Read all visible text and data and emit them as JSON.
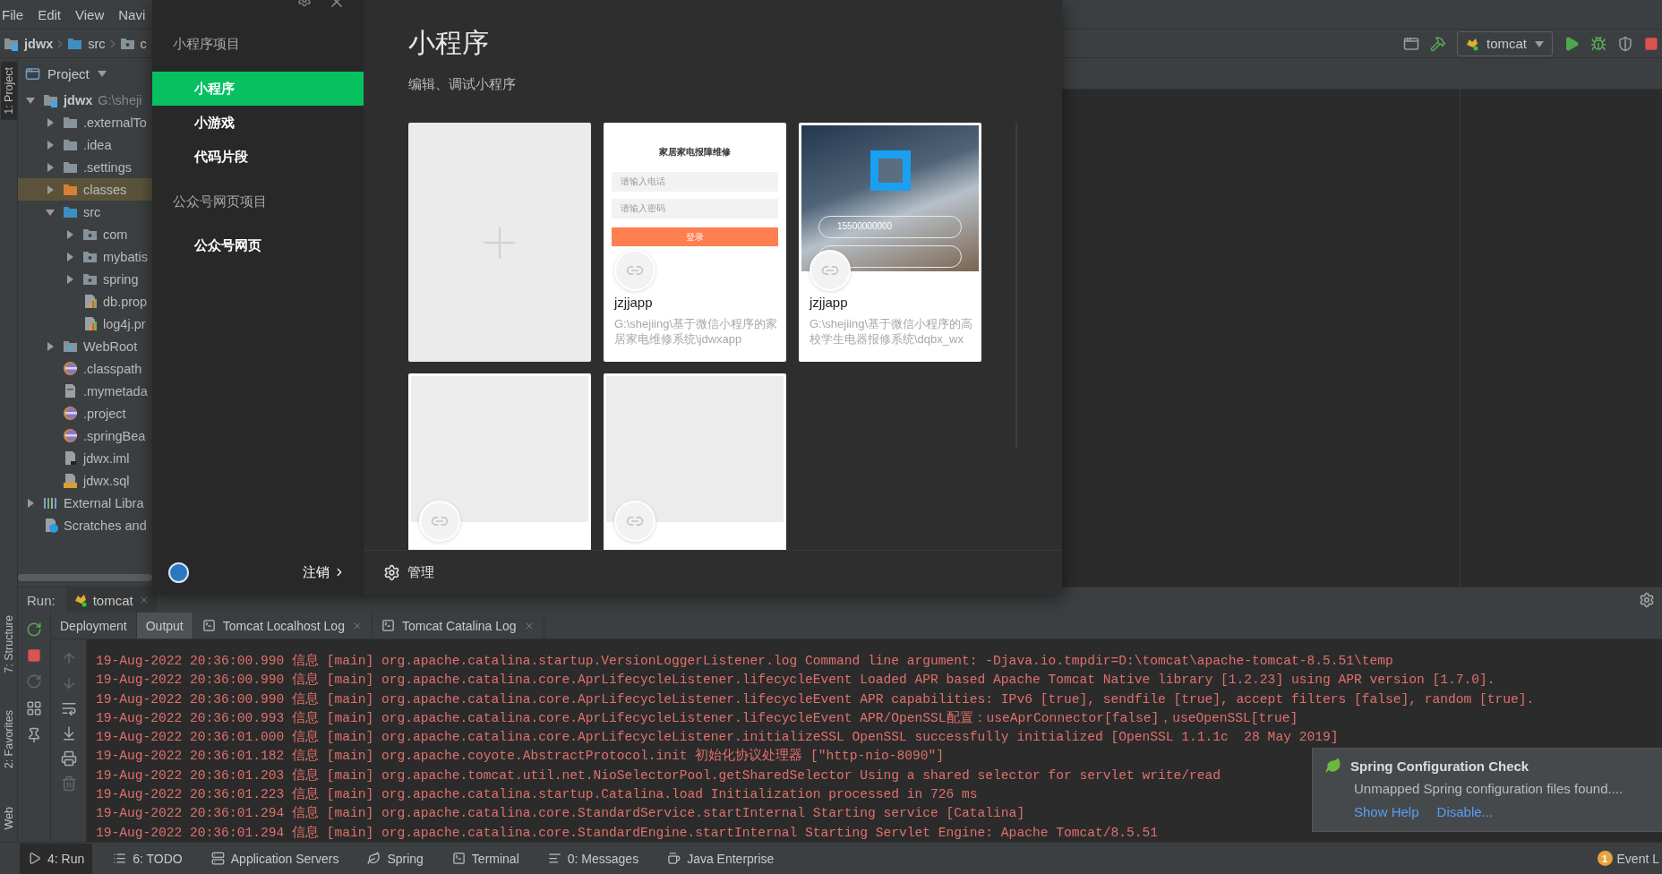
{
  "menu": [
    "File",
    "Edit",
    "View",
    "Navi"
  ],
  "breadcrumb": [
    {
      "label": "jdwx",
      "kind": "module"
    },
    {
      "label": "src",
      "kind": "source"
    },
    {
      "label": "c",
      "kind": "package"
    }
  ],
  "toolbar": {
    "run_config": "tomcat"
  },
  "side_stripe": {
    "top": [
      {
        "label": "1: Project",
        "selected": true
      }
    ],
    "bottom": [
      {
        "label": "7: Structure",
        "selected": false
      },
      {
        "label": "2: Favorites",
        "selected": false
      },
      {
        "label": "Web",
        "selected": false
      }
    ]
  },
  "project_panel": {
    "title": "Project",
    "tree": [
      {
        "name": "jdwx",
        "path": "G:\\sheji",
        "kind": "module",
        "expanded": true,
        "selected": false,
        "children": [
          {
            "name": ".externalTo",
            "kind": "folder",
            "expanded": false,
            "selected": false
          },
          {
            "name": ".idea",
            "kind": "folder",
            "expanded": false,
            "selected": false
          },
          {
            "name": ".settings",
            "kind": "folder",
            "expanded": false,
            "selected": false
          },
          {
            "name": "classes",
            "kind": "excluded",
            "expanded": false,
            "selected": true
          },
          {
            "name": "src",
            "kind": "source",
            "expanded": true,
            "selected": false,
            "children": [
              {
                "name": "com",
                "kind": "package",
                "expanded": false,
                "selected": false
              },
              {
                "name": "mybatis",
                "kind": "package",
                "expanded": false,
                "selected": false
              },
              {
                "name": "spring",
                "kind": "package",
                "expanded": false,
                "selected": false
              },
              {
                "name": "db.prop",
                "kind": "properties",
                "selected": false
              },
              {
                "name": "log4j.pr",
                "kind": "properties",
                "selected": false
              }
            ]
          },
          {
            "name": "WebRoot",
            "kind": "web",
            "expanded": false,
            "selected": false
          },
          {
            "name": ".classpath",
            "kind": "eclipse",
            "selected": false
          },
          {
            "name": ".mymetada",
            "kind": "file",
            "selected": false
          },
          {
            "name": ".project",
            "kind": "eclipse",
            "selected": false
          },
          {
            "name": ".springBea",
            "kind": "eclipse",
            "selected": false
          },
          {
            "name": "jdwx.iml",
            "kind": "iml",
            "selected": false
          },
          {
            "name": "jdwx.sql",
            "kind": "sql",
            "selected": false
          }
        ]
      },
      {
        "name": "External Libra",
        "kind": "library",
        "expanded": false,
        "selected": false
      },
      {
        "name": "Scratches and",
        "kind": "scratch",
        "selected": false
      }
    ]
  },
  "dialog": {
    "sidebar": {
      "sections": [
        {
          "title": "小程序项目",
          "items": [
            {
              "label": "小程序",
              "selected": true
            },
            {
              "label": "小游戏",
              "selected": false
            },
            {
              "label": "代码片段",
              "selected": false
            }
          ]
        },
        {
          "title": "公众号网页项目",
          "items": [
            {
              "label": "公众号网页",
              "selected": false
            }
          ]
        }
      ],
      "logout": "注销"
    },
    "main": {
      "title": "小程序",
      "subtitle": "编辑、调试小程序",
      "projects": [
        {
          "kind": "new"
        },
        {
          "kind": "project",
          "name": "jzjjapp",
          "path": "G:\\shejiing\\基于微信小程序的家居家电维修系统\\jdwxapp",
          "preview": {
            "kind": "form",
            "title": "家居家电报障维修",
            "fields": [
              "请输入电话",
              "请输入密码"
            ],
            "button": "登录"
          }
        },
        {
          "kind": "project",
          "name": "jzjjapp",
          "path": "G:\\shejiing\\基于微信小程序的高校学生电器报修系统\\dqbx_wx",
          "preview": {
            "kind": "photo",
            "field": "15500000000"
          }
        },
        {
          "kind": "project",
          "preview": {
            "kind": "blank"
          }
        },
        {
          "kind": "project",
          "preview": {
            "kind": "blank"
          }
        }
      ],
      "manage": "管理"
    }
  },
  "run_panel": {
    "label": "Run:",
    "session": "tomcat",
    "tabs": [
      {
        "label": "Deployment",
        "kind": "plain",
        "selected": false
      },
      {
        "label": "Output",
        "kind": "plain",
        "selected": true
      },
      {
        "label": "Tomcat Localhost Log",
        "kind": "log",
        "selected": false
      },
      {
        "label": "Tomcat Catalina Log",
        "kind": "log",
        "selected": false
      }
    ],
    "lines": [
      "19-Aug-2022 20:36:00.990 信息 [main] org.apache.catalina.startup.VersionLoggerListener.log Command line argument: -Djava.io.tmpdir=D:\\tomcat\\apache-tomcat-8.5.51\\temp",
      "19-Aug-2022 20:36:00.990 信息 [main] org.apache.catalina.core.AprLifecycleListener.lifecycleEvent Loaded APR based Apache Tomcat Native library [1.2.23] using APR version [1.7.0].",
      "19-Aug-2022 20:36:00.990 信息 [main] org.apache.catalina.core.AprLifecycleListener.lifecycleEvent APR capabilities: IPv6 [true], sendfile [true], accept filters [false], random [true].",
      "19-Aug-2022 20:36:00.993 信息 [main] org.apache.catalina.core.AprLifecycleListener.lifecycleEvent APR/OpenSSL配置：useAprConnector[false]，useOpenSSL[true]",
      "19-Aug-2022 20:36:01.000 信息 [main] org.apache.catalina.core.AprLifecycleListener.initializeSSL OpenSSL successfully initialized [OpenSSL 1.1.1c  28 May 2019]",
      "19-Aug-2022 20:36:01.182 信息 [main] org.apache.coyote.AbstractProtocol.init 初始化协议处理器 [\"http-nio-8090\"]",
      "19-Aug-2022 20:36:01.203 信息 [main] org.apache.tomcat.util.net.NioSelectorPool.getSharedSelector Using a shared selector for servlet write/read",
      "19-Aug-2022 20:36:01.223 信息 [main] org.apache.catalina.startup.Catalina.load Initialization processed in 726 ms",
      "19-Aug-2022 20:36:01.294 信息 [main] org.apache.catalina.core.StandardService.startInternal Starting service [Catalina]",
      "19-Aug-2022 20:36:01.294 信息 [main] org.apache.catalina.core.StandardEngine.startInternal Starting Servlet Engine: Apache Tomcat/8.5.51"
    ]
  },
  "notification": {
    "title": "Spring Configuration Check",
    "body": "Unmapped Spring configuration files found....",
    "actions": [
      "Show Help",
      "Disable..."
    ]
  },
  "status_bar": {
    "items": [
      {
        "label": "4: Run",
        "kind": "run",
        "selected": true
      },
      {
        "label": "6: TODO",
        "kind": "todo",
        "selected": false
      },
      {
        "label": "Application Servers",
        "kind": "servers",
        "selected": false
      },
      {
        "label": "Spring",
        "kind": "spring",
        "selected": false
      },
      {
        "label": "Terminal",
        "kind": "terminal",
        "selected": false
      },
      {
        "label": "0: Messages",
        "kind": "messages",
        "selected": false
      },
      {
        "label": "Java Enterprise",
        "kind": "javaee",
        "selected": false
      }
    ],
    "event_log": {
      "label": "Event L",
      "badge": "1"
    }
  }
}
